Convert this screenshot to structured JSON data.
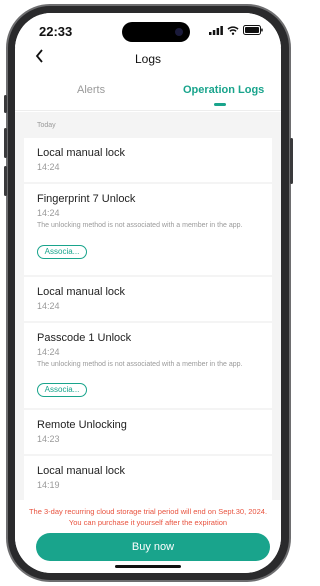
{
  "status": {
    "time": "22:33"
  },
  "nav": {
    "back_icon": "chevron-left-icon",
    "title": "Logs"
  },
  "tabs": [
    {
      "label": "Alerts",
      "active": false
    },
    {
      "label": "Operation Logs",
      "active": true
    }
  ],
  "day_label": "Today",
  "logs": [
    {
      "title": "Local manual lock",
      "time": "14:24"
    },
    {
      "title": "Fingerprint 7 Unlock",
      "time": "14:24",
      "note": "The unlocking method is not associated with a member in the app.",
      "action": "Associa..."
    },
    {
      "title": "Local manual lock",
      "time": "14:24"
    },
    {
      "title": "Passcode 1 Unlock",
      "time": "14:24",
      "note": "The unlocking method is not associated with a member in the app.",
      "action": "Associa..."
    },
    {
      "title": "Remote Unlocking",
      "time": "14:23"
    },
    {
      "title": "Local manual lock",
      "time": "14:19"
    }
  ],
  "promo_text": "The 3-day recurring cloud storage trial period will end on Sept.30, 2024. You can purchase it yourself after the expiration",
  "buy_label": "Buy now",
  "colors": {
    "accent": "#19a48c",
    "promo": "#e8533f",
    "background": "#f4f4f4"
  }
}
